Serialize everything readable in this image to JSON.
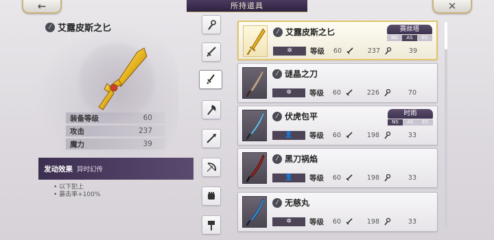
{
  "header": {
    "title": "所持道具",
    "back_icon": "←",
    "close_icon": "✕"
  },
  "detail": {
    "name": "艾露皮斯之匕",
    "stats": [
      {
        "label": "装备等级",
        "value": "60"
      },
      {
        "label": "攻击",
        "value": "237"
      },
      {
        "label": "魔力",
        "value": "39"
      }
    ],
    "effect_title": "发动效果",
    "effect_name": "异时幻传",
    "effect_lines": [
      "• 以下犯上",
      "• 暴击率+100%"
    ]
  },
  "tabs": [
    {
      "name": "staff"
    },
    {
      "name": "sword"
    },
    {
      "name": "dagger",
      "active": true
    },
    {
      "name": "axe"
    },
    {
      "name": "spear"
    },
    {
      "name": "bow"
    },
    {
      "name": "fist"
    },
    {
      "name": "hammer"
    }
  ],
  "items": [
    {
      "name": "艾露皮斯之匕",
      "glyph": "✲",
      "level_label": "等级",
      "level": "60",
      "attack": "237",
      "magic": "39",
      "tag": "赛丝塔",
      "ns": [
        "NS",
        "AS",
        "ES"
      ],
      "ns_active": 1,
      "selected": true,
      "blade_color": "#e6b520"
    },
    {
      "name": "谜晶之刀",
      "glyph": "✲",
      "level_label": "等级",
      "level": "60",
      "attack": "226",
      "magic": "70",
      "tag": "",
      "selected": false,
      "blade_color": "#b9a58f"
    },
    {
      "name": "伏虎包平",
      "glyph": "👤",
      "level_label": "等级",
      "level": "60",
      "attack": "198",
      "magic": "33",
      "tag": "时雨",
      "ns": [
        "NS",
        "AS",
        "ES"
      ],
      "ns_active": 0,
      "selected": false,
      "blade_color": "#7fb8d8"
    },
    {
      "name": "黑刀祸焰",
      "glyph": "👤",
      "level_label": "等级",
      "level": "60",
      "attack": "198",
      "magic": "33",
      "tag": "",
      "selected": false,
      "blade_color": "#9a2a22"
    },
    {
      "name": "无慈丸",
      "glyph": "✲",
      "level_label": "等级",
      "level": "60",
      "attack": "198",
      "magic": "33",
      "tag": "",
      "selected": false,
      "blade_color": "#3f8fd0"
    }
  ],
  "colors": {
    "accent": "#4d4458",
    "gold": "#e2c46a"
  }
}
